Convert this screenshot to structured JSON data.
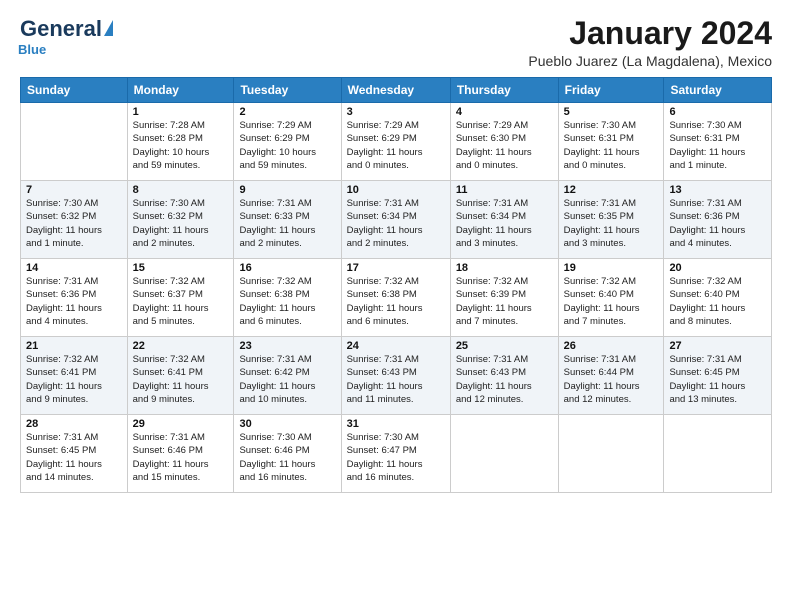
{
  "header": {
    "logo_general": "General",
    "logo_blue": "Blue",
    "title": "January 2024",
    "subtitle": "Pueblo Juarez (La Magdalena), Mexico"
  },
  "calendar": {
    "days_of_week": [
      "Sunday",
      "Monday",
      "Tuesday",
      "Wednesday",
      "Thursday",
      "Friday",
      "Saturday"
    ],
    "weeks": [
      [
        {
          "day": "",
          "info": ""
        },
        {
          "day": "1",
          "info": "Sunrise: 7:28 AM\nSunset: 6:28 PM\nDaylight: 10 hours\nand 59 minutes."
        },
        {
          "day": "2",
          "info": "Sunrise: 7:29 AM\nSunset: 6:29 PM\nDaylight: 10 hours\nand 59 minutes."
        },
        {
          "day": "3",
          "info": "Sunrise: 7:29 AM\nSunset: 6:29 PM\nDaylight: 11 hours\nand 0 minutes."
        },
        {
          "day": "4",
          "info": "Sunrise: 7:29 AM\nSunset: 6:30 PM\nDaylight: 11 hours\nand 0 minutes."
        },
        {
          "day": "5",
          "info": "Sunrise: 7:30 AM\nSunset: 6:31 PM\nDaylight: 11 hours\nand 0 minutes."
        },
        {
          "day": "6",
          "info": "Sunrise: 7:30 AM\nSunset: 6:31 PM\nDaylight: 11 hours\nand 1 minute."
        }
      ],
      [
        {
          "day": "7",
          "info": "Sunrise: 7:30 AM\nSunset: 6:32 PM\nDaylight: 11 hours\nand 1 minute."
        },
        {
          "day": "8",
          "info": "Sunrise: 7:30 AM\nSunset: 6:32 PM\nDaylight: 11 hours\nand 2 minutes."
        },
        {
          "day": "9",
          "info": "Sunrise: 7:31 AM\nSunset: 6:33 PM\nDaylight: 11 hours\nand 2 minutes."
        },
        {
          "day": "10",
          "info": "Sunrise: 7:31 AM\nSunset: 6:34 PM\nDaylight: 11 hours\nand 2 minutes."
        },
        {
          "day": "11",
          "info": "Sunrise: 7:31 AM\nSunset: 6:34 PM\nDaylight: 11 hours\nand 3 minutes."
        },
        {
          "day": "12",
          "info": "Sunrise: 7:31 AM\nSunset: 6:35 PM\nDaylight: 11 hours\nand 3 minutes."
        },
        {
          "day": "13",
          "info": "Sunrise: 7:31 AM\nSunset: 6:36 PM\nDaylight: 11 hours\nand 4 minutes."
        }
      ],
      [
        {
          "day": "14",
          "info": "Sunrise: 7:31 AM\nSunset: 6:36 PM\nDaylight: 11 hours\nand 4 minutes."
        },
        {
          "day": "15",
          "info": "Sunrise: 7:32 AM\nSunset: 6:37 PM\nDaylight: 11 hours\nand 5 minutes."
        },
        {
          "day": "16",
          "info": "Sunrise: 7:32 AM\nSunset: 6:38 PM\nDaylight: 11 hours\nand 6 minutes."
        },
        {
          "day": "17",
          "info": "Sunrise: 7:32 AM\nSunset: 6:38 PM\nDaylight: 11 hours\nand 6 minutes."
        },
        {
          "day": "18",
          "info": "Sunrise: 7:32 AM\nSunset: 6:39 PM\nDaylight: 11 hours\nand 7 minutes."
        },
        {
          "day": "19",
          "info": "Sunrise: 7:32 AM\nSunset: 6:40 PM\nDaylight: 11 hours\nand 7 minutes."
        },
        {
          "day": "20",
          "info": "Sunrise: 7:32 AM\nSunset: 6:40 PM\nDaylight: 11 hours\nand 8 minutes."
        }
      ],
      [
        {
          "day": "21",
          "info": "Sunrise: 7:32 AM\nSunset: 6:41 PM\nDaylight: 11 hours\nand 9 minutes."
        },
        {
          "day": "22",
          "info": "Sunrise: 7:32 AM\nSunset: 6:41 PM\nDaylight: 11 hours\nand 9 minutes."
        },
        {
          "day": "23",
          "info": "Sunrise: 7:31 AM\nSunset: 6:42 PM\nDaylight: 11 hours\nand 10 minutes."
        },
        {
          "day": "24",
          "info": "Sunrise: 7:31 AM\nSunset: 6:43 PM\nDaylight: 11 hours\nand 11 minutes."
        },
        {
          "day": "25",
          "info": "Sunrise: 7:31 AM\nSunset: 6:43 PM\nDaylight: 11 hours\nand 12 minutes."
        },
        {
          "day": "26",
          "info": "Sunrise: 7:31 AM\nSunset: 6:44 PM\nDaylight: 11 hours\nand 12 minutes."
        },
        {
          "day": "27",
          "info": "Sunrise: 7:31 AM\nSunset: 6:45 PM\nDaylight: 11 hours\nand 13 minutes."
        }
      ],
      [
        {
          "day": "28",
          "info": "Sunrise: 7:31 AM\nSunset: 6:45 PM\nDaylight: 11 hours\nand 14 minutes."
        },
        {
          "day": "29",
          "info": "Sunrise: 7:31 AM\nSunset: 6:46 PM\nDaylight: 11 hours\nand 15 minutes."
        },
        {
          "day": "30",
          "info": "Sunrise: 7:30 AM\nSunset: 6:46 PM\nDaylight: 11 hours\nand 16 minutes."
        },
        {
          "day": "31",
          "info": "Sunrise: 7:30 AM\nSunset: 6:47 PM\nDaylight: 11 hours\nand 16 minutes."
        },
        {
          "day": "",
          "info": ""
        },
        {
          "day": "",
          "info": ""
        },
        {
          "day": "",
          "info": ""
        }
      ]
    ]
  }
}
